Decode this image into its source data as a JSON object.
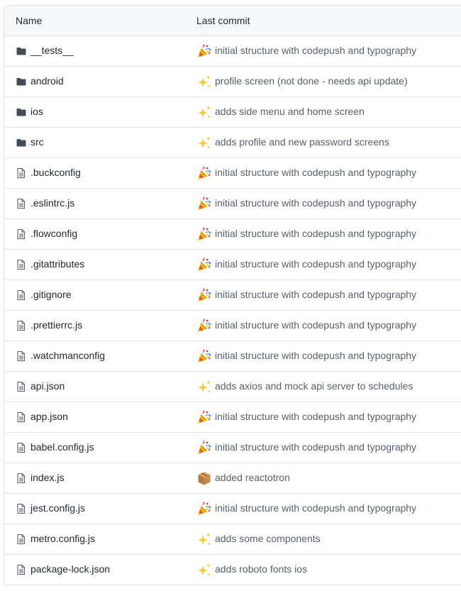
{
  "header": {
    "name_label": "Name",
    "commit_label": "Last commit"
  },
  "files": [
    {
      "name": "__tests__",
      "type": "folder",
      "commit": "initial structure with codepush and typography",
      "emoji": "tada"
    },
    {
      "name": "android",
      "type": "folder",
      "commit": "profile screen (not done - needs api update)",
      "emoji": "sparkles"
    },
    {
      "name": "ios",
      "type": "folder",
      "commit": "adds side menu and home screen",
      "emoji": "sparkles"
    },
    {
      "name": "src",
      "type": "folder",
      "commit": "adds profile and new password screens",
      "emoji": "sparkles"
    },
    {
      "name": ".buckconfig",
      "type": "file",
      "commit": "initial structure with codepush and typography",
      "emoji": "tada"
    },
    {
      "name": ".eslintrc.js",
      "type": "file",
      "commit": "initial structure with codepush and typography",
      "emoji": "tada"
    },
    {
      "name": ".flowconfig",
      "type": "file",
      "commit": "initial structure with codepush and typography",
      "emoji": "tada"
    },
    {
      "name": ".gitattributes",
      "type": "file",
      "commit": "initial structure with codepush and typography",
      "emoji": "tada"
    },
    {
      "name": ".gitignore",
      "type": "file",
      "commit": "initial structure with codepush and typography",
      "emoji": "tada"
    },
    {
      "name": ".prettierrc.js",
      "type": "file",
      "commit": "initial structure with codepush and typography",
      "emoji": "tada"
    },
    {
      "name": ".watchmanconfig",
      "type": "file",
      "commit": "initial structure with codepush and typography",
      "emoji": "tada"
    },
    {
      "name": "api.json",
      "type": "file",
      "commit": "adds axios and mock api server to schedules",
      "emoji": "sparkles"
    },
    {
      "name": "app.json",
      "type": "file",
      "commit": "initial structure with codepush and typography",
      "emoji": "tada"
    },
    {
      "name": "babel.config.js",
      "type": "file",
      "commit": "initial structure with codepush and typography",
      "emoji": "tada"
    },
    {
      "name": "index.js",
      "type": "file",
      "commit": "added reactotron",
      "emoji": "package"
    },
    {
      "name": "jest.config.js",
      "type": "file",
      "commit": "initial structure with codepush and typography",
      "emoji": "tada"
    },
    {
      "name": "metro.config.js",
      "type": "file",
      "commit": "adds some components",
      "emoji": "sparkles"
    },
    {
      "name": "package-lock.json",
      "type": "file",
      "commit": "adds roboto fonts ios",
      "emoji": "sparkles"
    }
  ],
  "colors": {
    "border": "#e1e4e8",
    "header_bg": "#f6f8fa",
    "icon": "#444d56",
    "commit_text": "#586069"
  }
}
